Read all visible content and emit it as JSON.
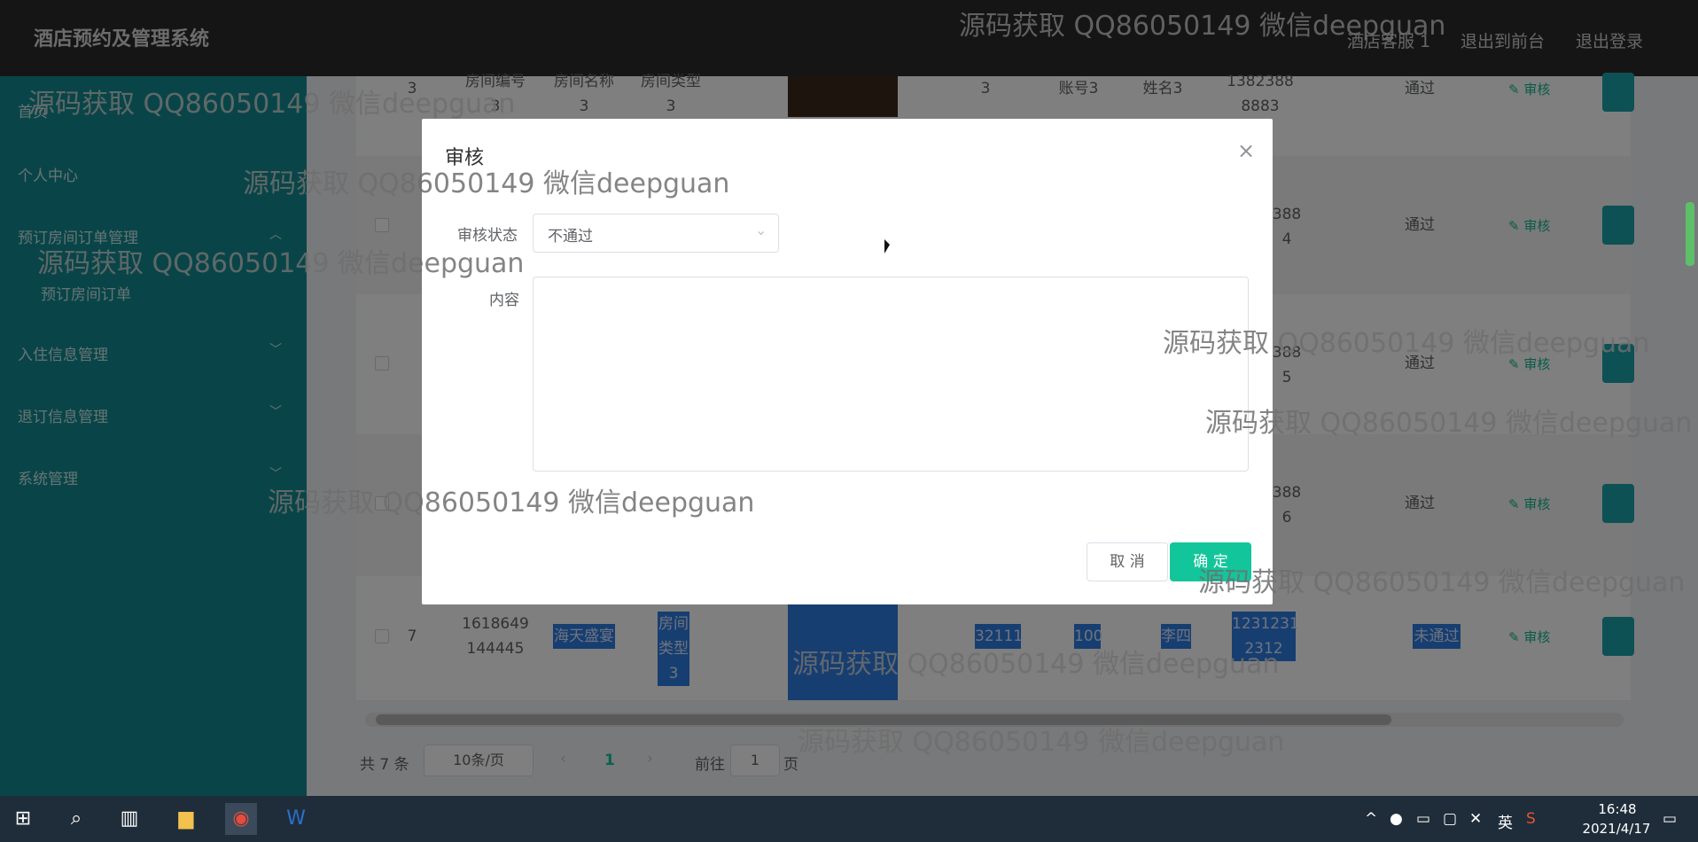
{
  "app": {
    "title": "酒店预约及管理系统",
    "top_links": [
      "酒店客服 1",
      "退出到前台",
      "退出登录"
    ]
  },
  "sidebar": {
    "items": [
      {
        "label": "首页"
      },
      {
        "label": "个人中心"
      },
      {
        "label": "预订房间订单管理",
        "expanded": true,
        "children": [
          "预订房间订单"
        ]
      },
      {
        "label": "入住信息管理"
      },
      {
        "label": "退订信息管理"
      },
      {
        "label": "系统管理"
      }
    ]
  },
  "table": {
    "rows": [
      {
        "index": "3",
        "c1": "房间编号\n3",
        "c2": "房间名称\n3",
        "c3": "房间类型\n3",
        "c4": "3",
        "c5": "账号3",
        "c6": "姓名3",
        "c7": "1382388\n8883",
        "status": "通过",
        "audit": "审核"
      },
      {
        "index": "",
        "c7": "388\n4",
        "status": "通过",
        "audit": "审核"
      },
      {
        "index": "",
        "c7": "388\n5",
        "status": "通过",
        "audit": "审核"
      },
      {
        "index": "",
        "c7": "388\n6",
        "status": "通过",
        "audit": "审核"
      },
      {
        "index": "7",
        "c1": "1618649\n144445",
        "c2": "海天盛宴",
        "c3": "房间类型\n3",
        "c4": "32111",
        "c5": "100",
        "c6": "李四",
        "c7": "1231231\n2312",
        "status": "未通过",
        "audit": "审核"
      }
    ]
  },
  "pager": {
    "total": "共 7 条",
    "page_size": "10条/页",
    "current": "1",
    "goto_prefix": "前往",
    "goto_value": "1",
    "goto_suffix": "页"
  },
  "modal": {
    "title": "审核",
    "status_label": "审核状态",
    "status_value": "不通过",
    "content_label": "内容",
    "content_value": "",
    "cancel_label": "取 消",
    "ok_label": "确 定"
  },
  "watermark": "源码获取 QQ86050149 微信deepguan",
  "taskbar": {
    "time": "16:48",
    "date": "2021/4/17",
    "ime": "英"
  },
  "colors": {
    "sidebar": "#128a91",
    "accent": "#13c59a",
    "topbar": "#2a2a2a"
  }
}
